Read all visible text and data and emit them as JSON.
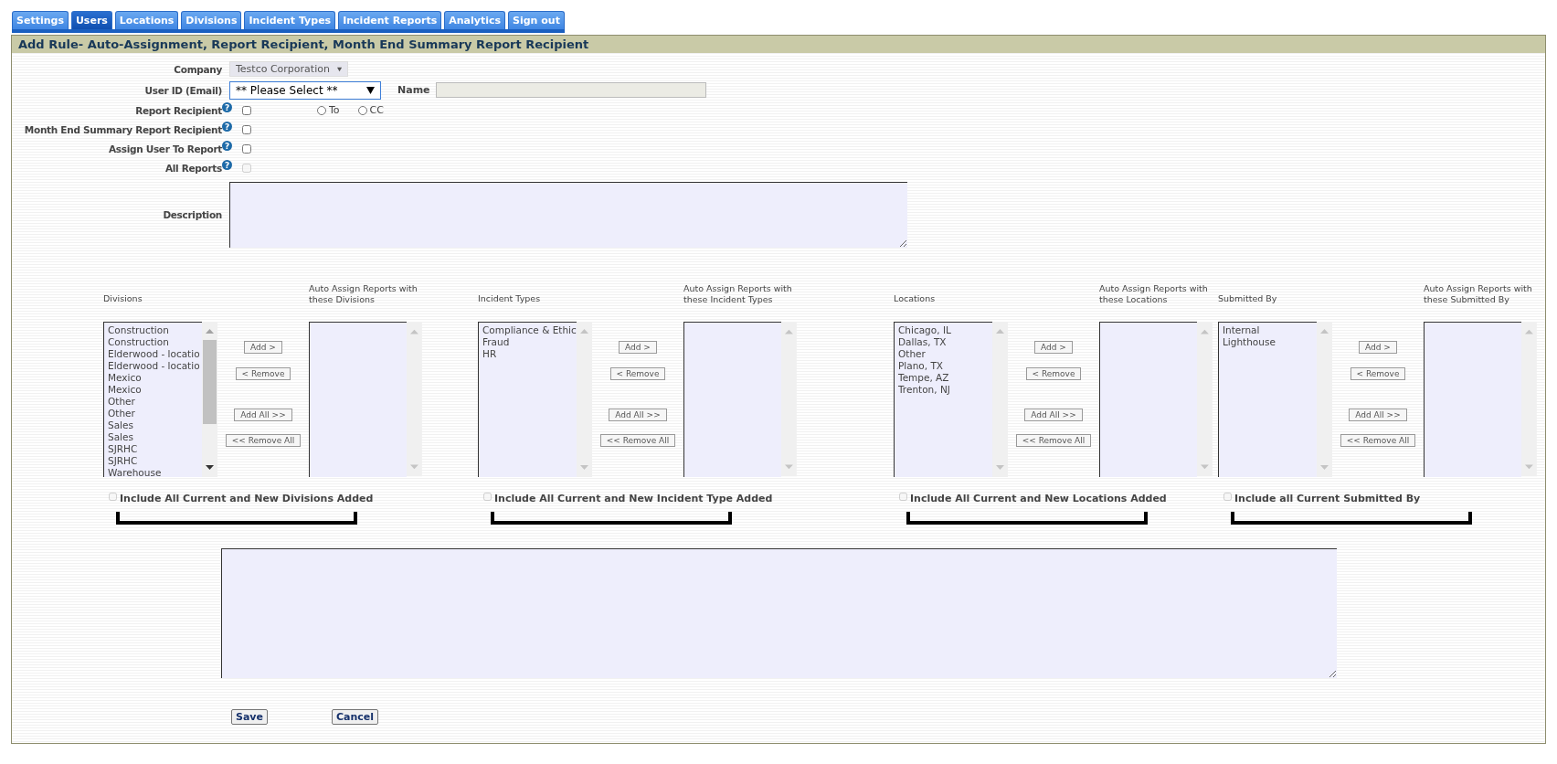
{
  "tabs": [
    {
      "label": "Settings",
      "selected": false
    },
    {
      "label": "Users",
      "selected": true
    },
    {
      "label": "Locations",
      "selected": false
    },
    {
      "label": "Divisions",
      "selected": false
    },
    {
      "label": "Incident Types",
      "selected": false
    },
    {
      "label": "Incident Reports",
      "selected": false
    },
    {
      "label": "Analytics",
      "selected": false
    },
    {
      "label": "Sign out",
      "selected": false
    }
  ],
  "panel_title": "Add Rule- Auto-Assignment, Report Recipient, Month End Summary Report Recipient",
  "company": {
    "label": "Company",
    "value": "Testco Corporation"
  },
  "user_id": {
    "label": "User ID (Email)",
    "value": "** Please Select **"
  },
  "name": {
    "label": "Name"
  },
  "checkbox_rows": [
    {
      "label": "Report Recipient",
      "help": "?",
      "checked": false,
      "disabled": false,
      "options": [
        {
          "label": "To",
          "selected": false
        },
        {
          "label": "CC",
          "selected": false
        }
      ]
    },
    {
      "label": "Month End Summary Report Recipient",
      "help": "?",
      "checked": false,
      "disabled": false
    },
    {
      "label": "Assign User To Report",
      "help": "?",
      "checked": false,
      "disabled": false
    },
    {
      "label": "All Reports",
      "help": "?",
      "checked": false,
      "disabled": true
    }
  ],
  "description": {
    "label": "Description"
  },
  "groups": [
    {
      "source_label": "Divisions",
      "target_label": "Auto Assign Reports with these Divisions",
      "source_items": [
        "Construction",
        "Construction",
        "Elderwood - locatio",
        "Elderwood - locatio",
        "Mexico",
        "Mexico",
        "Other",
        "Other",
        "Sales",
        "Sales",
        "SJRHC",
        "SJRHC",
        "Warehouse"
      ],
      "buttons": [
        "Add >",
        "< Remove",
        "Add All >>",
        "<< Remove All"
      ],
      "include_label": "Include All Current and New Divisions Added",
      "include_checked": false
    },
    {
      "source_label": "Incident Types",
      "target_label": "Auto Assign Reports with these Incident Types",
      "source_items": [
        "Compliance & Ethic",
        "Fraud",
        "HR"
      ],
      "buttons": [
        "Add >",
        "< Remove",
        "Add All >>",
        "<< Remove All"
      ],
      "include_label": "Include All Current and New Incident Type Added",
      "include_checked": false
    },
    {
      "source_label": "Locations",
      "target_label": "Auto Assign Reports with these Locations",
      "source_items": [
        "Chicago, IL",
        "Dallas, TX",
        "Other",
        "Plano, TX",
        "Tempe, AZ",
        "Trenton, NJ"
      ],
      "buttons": [
        "Add >",
        "< Remove",
        "Add All >>",
        "<< Remove All"
      ],
      "include_label": "Include All Current and New Locations Added",
      "include_checked": false
    },
    {
      "source_label": "Submitted By",
      "target_label": "Auto Assign Reports with these Submitted By",
      "source_items": [
        "Internal",
        "Lighthouse"
      ],
      "buttons": [
        "Add >",
        "< Remove",
        "Add All >>",
        "<< Remove All"
      ],
      "include_label": "Include all Current Submitted By",
      "include_checked": false
    }
  ],
  "actions": [
    "Save",
    "Cancel"
  ]
}
